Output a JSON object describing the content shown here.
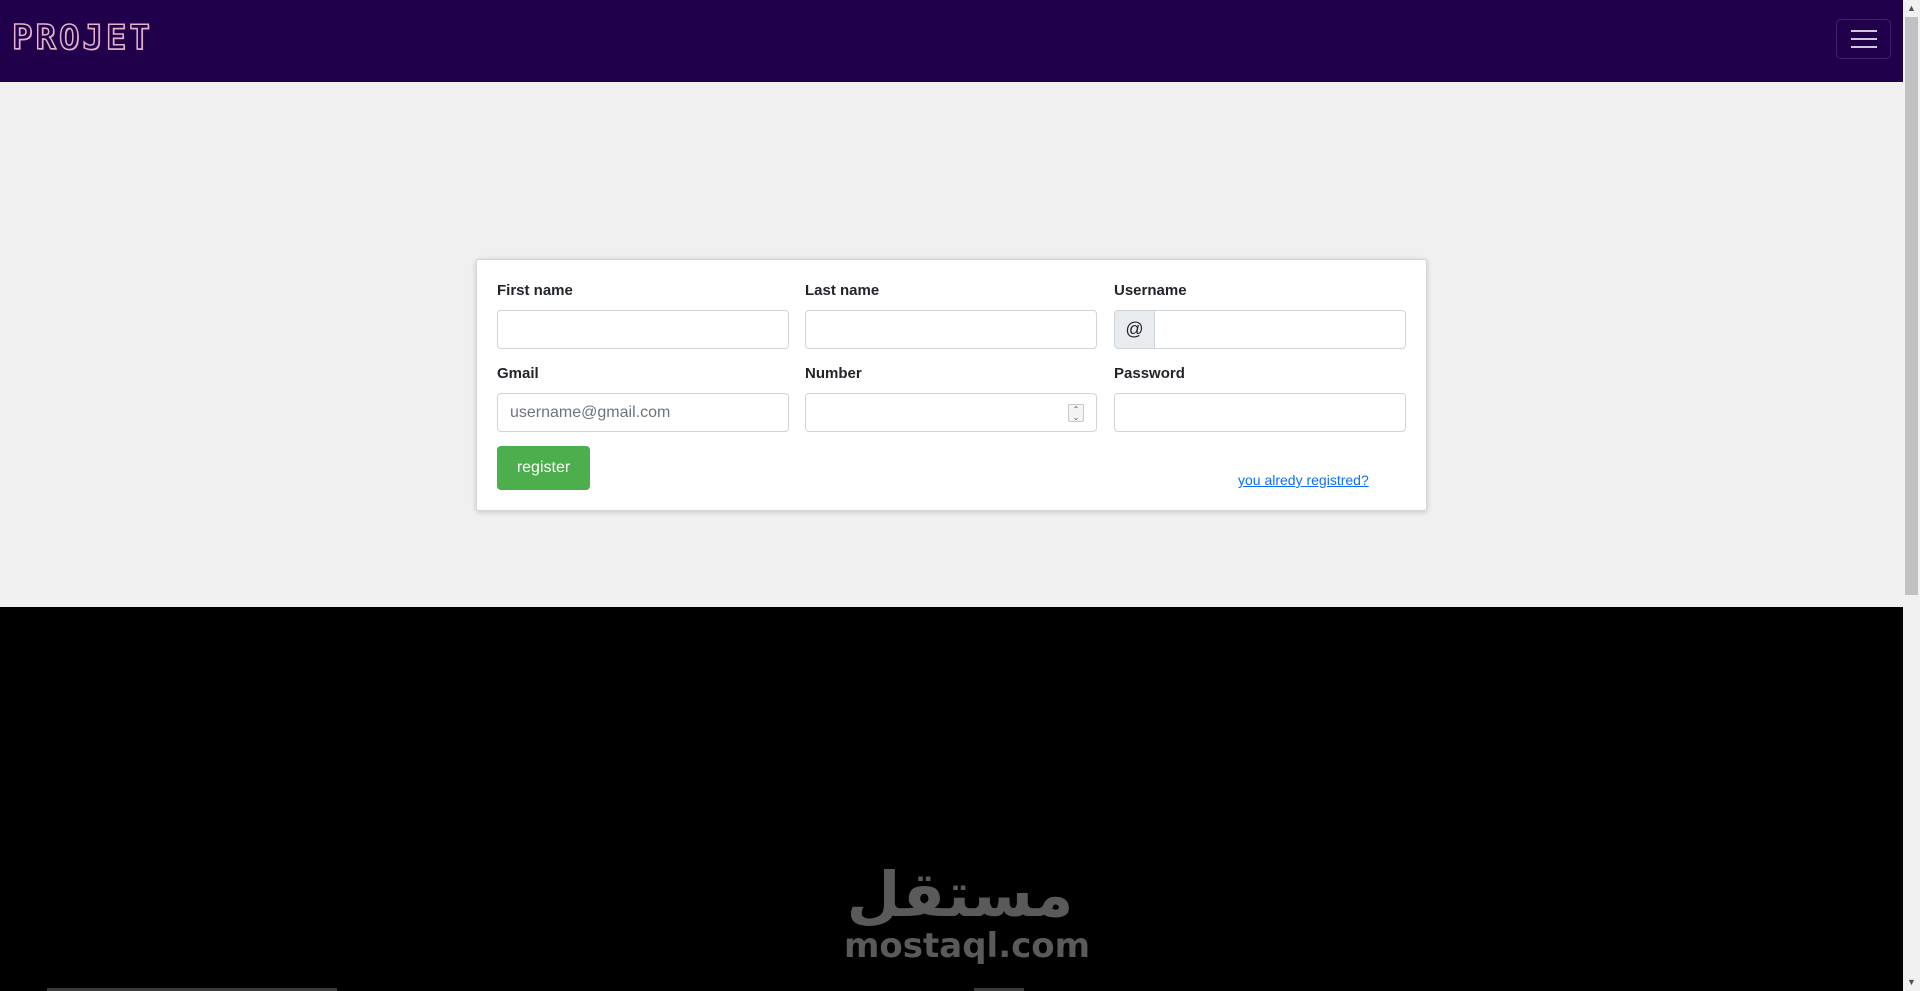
{
  "navbar": {
    "brand": "PROJET",
    "toggler_icon": "hamburger-menu-icon",
    "background": "#21004b"
  },
  "form": {
    "first_name": {
      "label": "First name",
      "value": "",
      "placeholder": ""
    },
    "last_name": {
      "label": "Last name",
      "value": "",
      "placeholder": ""
    },
    "username": {
      "label": "Username",
      "prefix": "@",
      "value": "",
      "placeholder": ""
    },
    "gmail": {
      "label": "Gmail",
      "value": "",
      "placeholder": "username@gmail.com"
    },
    "number": {
      "label": "Number",
      "value": "",
      "placeholder": ""
    },
    "password": {
      "label": "Password",
      "value": "",
      "placeholder": ""
    },
    "register_label": "register",
    "register_color": "#4cae4c",
    "login_link": "you alredy registred?"
  },
  "footer": {
    "watermark_arabic": "مستقل",
    "watermark_latin": "mostaql.com"
  }
}
